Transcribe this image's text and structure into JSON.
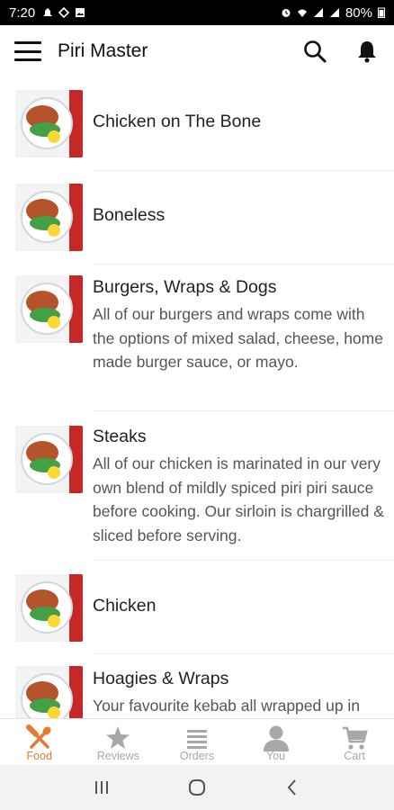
{
  "status_bar": {
    "time": "7:20",
    "battery": "80%"
  },
  "app_bar": {
    "title": "Piri Master"
  },
  "menu_items": [
    {
      "title": "Chicken on The Bone",
      "description": ""
    },
    {
      "title": "Boneless",
      "description": ""
    },
    {
      "title": "Burgers, Wraps & Dogs",
      "description": "All of our burgers and wraps come with the options of mixed salad, cheese, home made burger sauce, or mayo."
    },
    {
      "title": "Steaks",
      "description": "All of our chicken is marinated in our very own blend of mildly spiced piri piri sauce before cooking. Our sirloin is chargrilled & sliced before serving."
    },
    {
      "title": "Chicken",
      "description": ""
    },
    {
      "title": "Hoagies & Wraps",
      "description": "Your favourite kebab all wrapped up in"
    }
  ],
  "bottom_nav": {
    "tabs": [
      {
        "label": "Food",
        "icon": "fork-knife-icon",
        "active": true
      },
      {
        "label": "Reviews",
        "icon": "star-icon",
        "active": false
      },
      {
        "label": "Orders",
        "icon": "list-icon",
        "active": false
      },
      {
        "label": "You",
        "icon": "person-icon",
        "active": false
      },
      {
        "label": "Cart",
        "icon": "cart-icon",
        "active": false
      }
    ]
  },
  "colors": {
    "accent": "#e87b2f",
    "inactive": "#a8a8a8"
  }
}
